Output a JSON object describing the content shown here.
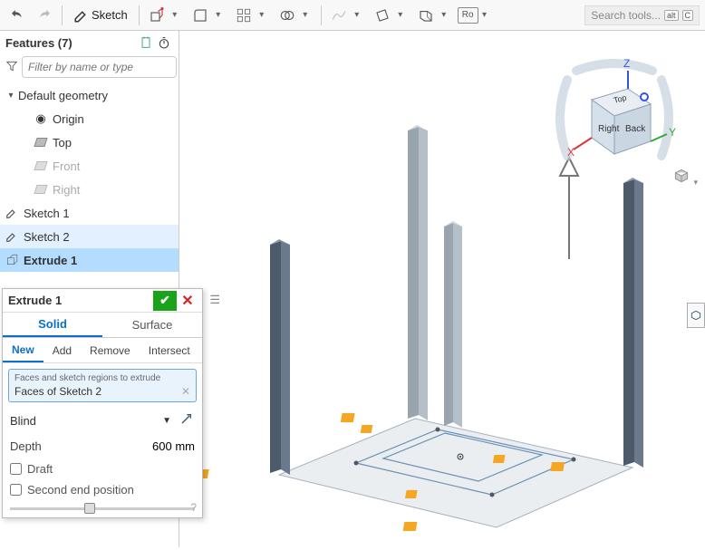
{
  "toolbar": {
    "sketch_label": "Sketch",
    "search_placeholder": "Search tools...",
    "kbd1": "alt",
    "kbd2": "C",
    "ro_label": "Ro"
  },
  "features": {
    "title": "Features (7)",
    "filter_placeholder": "Filter by name or type",
    "root": "Default geometry",
    "origin": "Origin",
    "top": "Top",
    "front": "Front",
    "right": "Right",
    "sketch1": "Sketch 1",
    "sketch2": "Sketch 2",
    "extrude1": "Extrude 1"
  },
  "dialog": {
    "title": "Extrude 1",
    "tab_solid": "Solid",
    "tab_surface": "Surface",
    "op_new": "New",
    "op_add": "Add",
    "op_remove": "Remove",
    "op_intersect": "Intersect",
    "sel_label": "Faces and sketch regions to extrude",
    "sel_value": "Faces of Sketch 2",
    "end_type": "Blind",
    "depth_label": "Depth",
    "depth_value": "600 mm",
    "draft_label": "Draft",
    "second_label": "Second end position"
  },
  "viewcube": {
    "x": "X",
    "y": "Y",
    "z": "Z",
    "top": "Top",
    "right": "Right",
    "back": "Back"
  }
}
